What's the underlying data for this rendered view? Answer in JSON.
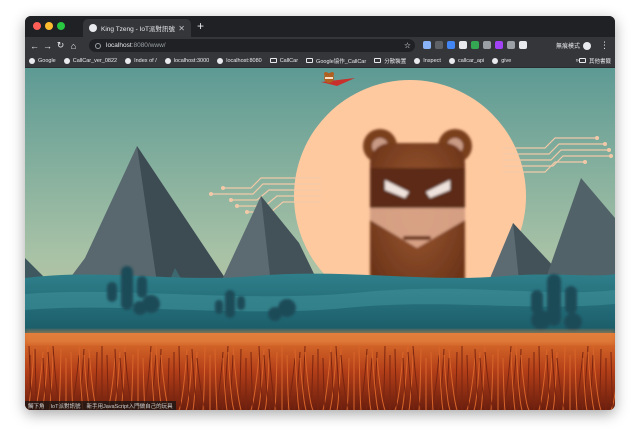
{
  "window": {
    "traffic_lights": [
      "#ff5f57",
      "#febc2e",
      "#28c840"
    ]
  },
  "tab": {
    "title": "King Tzeng - IoT派對訊號 | 創...",
    "close_glyph": "✕",
    "newtab_glyph": "+"
  },
  "toolbar": {
    "back": "←",
    "forward": "→",
    "reload": "↻",
    "home": "⌂",
    "url_host": "localhost",
    "url_path": ":8080/www/",
    "star": "☆",
    "incognito_label": "無痕模式",
    "menu": "⋮",
    "extension_colors": [
      "#8ab4f8",
      "#5f6368",
      "#4285f4",
      "#e8eaed",
      "#34a853",
      "#9aa0a6",
      "#a142f4",
      "#9aa0a6",
      "#e8eaed"
    ]
  },
  "bookmarks": {
    "items": [
      {
        "label": "Google",
        "type": "site"
      },
      {
        "label": "CallCar_ver_0822",
        "type": "site"
      },
      {
        "label": "Index of /",
        "type": "site"
      },
      {
        "label": "localhost:3000",
        "type": "site"
      },
      {
        "label": "localhost:8080",
        "type": "site"
      },
      {
        "label": "CallCar",
        "type": "folder"
      },
      {
        "label": "Google協作_CallCar",
        "type": "folder"
      },
      {
        "label": "分散裝置",
        "type": "folder"
      },
      {
        "label": "Inspect",
        "type": "site"
      },
      {
        "label": "callcar_api",
        "type": "site"
      },
      {
        "label": "give",
        "type": "site"
      }
    ],
    "more": "»",
    "other": "其他書籤"
  },
  "status_bar": {
    "items": [
      "觸下角",
      "IoT派對訊號",
      "新手用JavaScript入門做自己的玩具"
    ]
  },
  "scene": {
    "sky_top": "#5d9a94",
    "sky_bottom": "#d9c9a0",
    "sun_color": "#ffc9a0",
    "mountain_color": "#4f6168",
    "bear_color": "#8a4a2a",
    "grass_color": "#c24a1c"
  }
}
